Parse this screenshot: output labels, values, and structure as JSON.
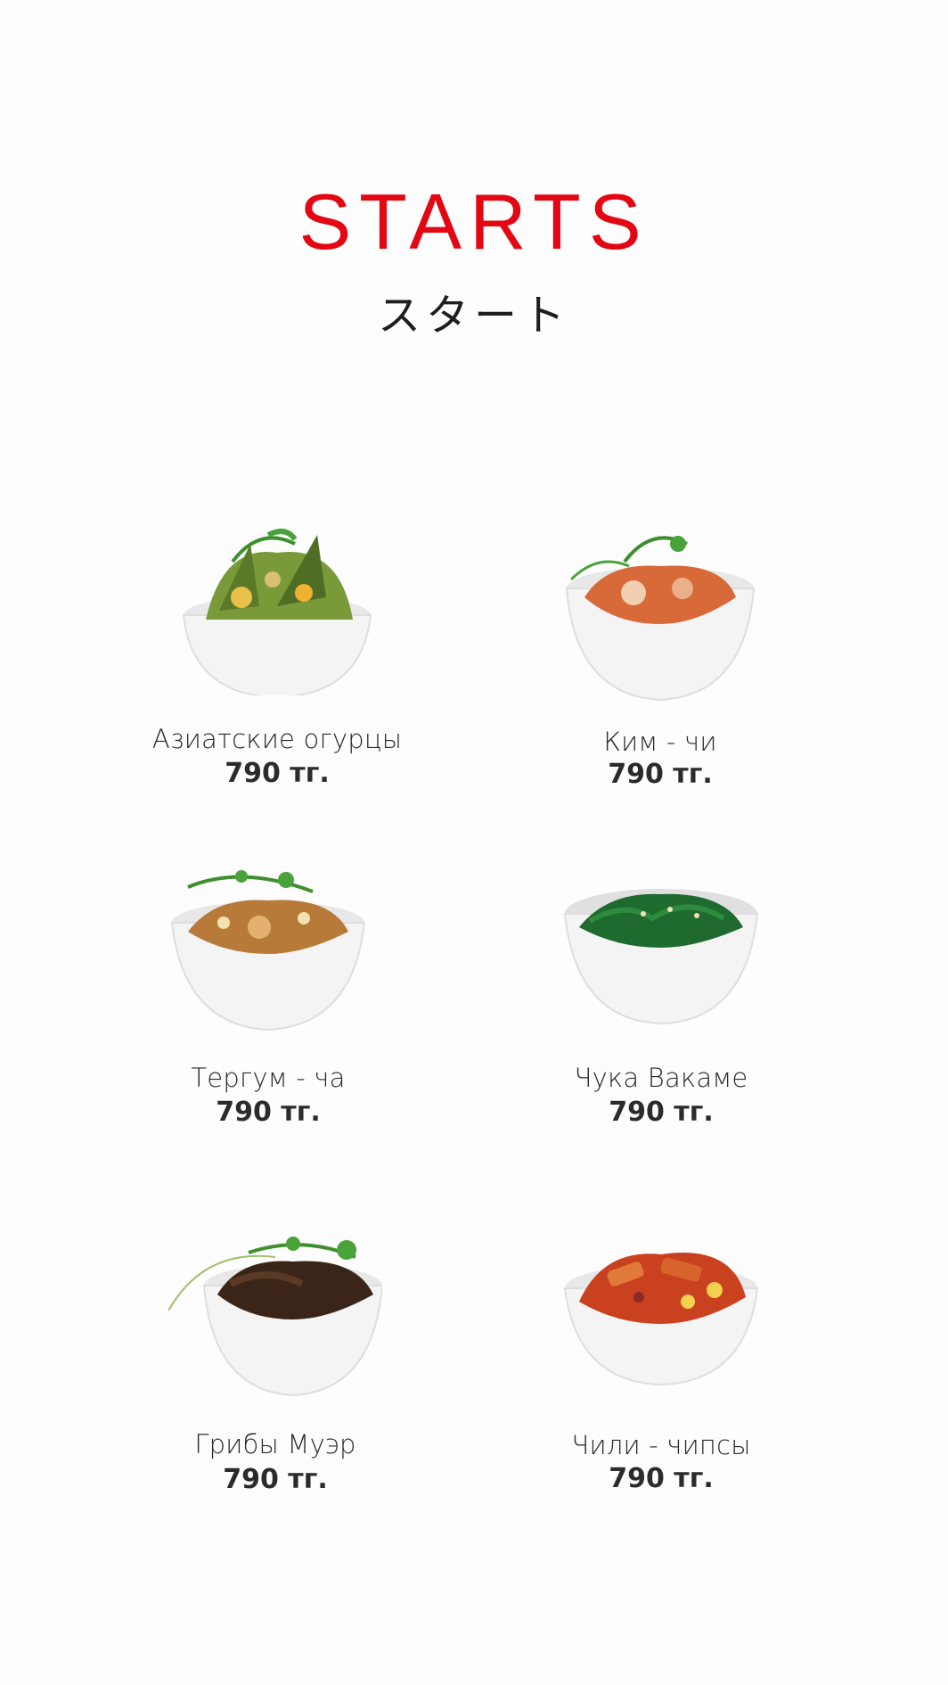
{
  "header": {
    "title": "STARTS",
    "subtitle": "スタート"
  },
  "colors": {
    "title": "#e30613",
    "text": "#2a2a2a",
    "bowl": "#f2f2f2"
  },
  "menu": {
    "items": [
      {
        "name": "Азиатские огурцы",
        "price": "790 тг.",
        "photo_icon": "cucumber-salad-bowl-icon",
        "food_color": "#7a9a3a",
        "garnish": true
      },
      {
        "name": "Ким - чи",
        "price": "790 тг.",
        "photo_icon": "kimchi-bowl-icon",
        "food_color": "#d86a3a",
        "garnish": true
      },
      {
        "name": "Тергум - ча",
        "price": "790 тг.",
        "photo_icon": "tergum-cha-bowl-icon",
        "food_color": "#b87a38",
        "garnish": true
      },
      {
        "name": "Чука Вакаме",
        "price": "790 тг.",
        "photo_icon": "wakame-seaweed-bowl-icon",
        "food_color": "#1f6a2e",
        "garnish": false
      },
      {
        "name": "Грибы Муэр",
        "price": "790 тг.",
        "photo_icon": "mu-er-mushroom-bowl-icon",
        "food_color": "#3b2518",
        "garnish": true
      },
      {
        "name": "Чили - чипсы",
        "price": "790 тг.",
        "photo_icon": "chili-chips-bowl-icon",
        "food_color": "#c9411f",
        "garnish": false
      }
    ]
  }
}
